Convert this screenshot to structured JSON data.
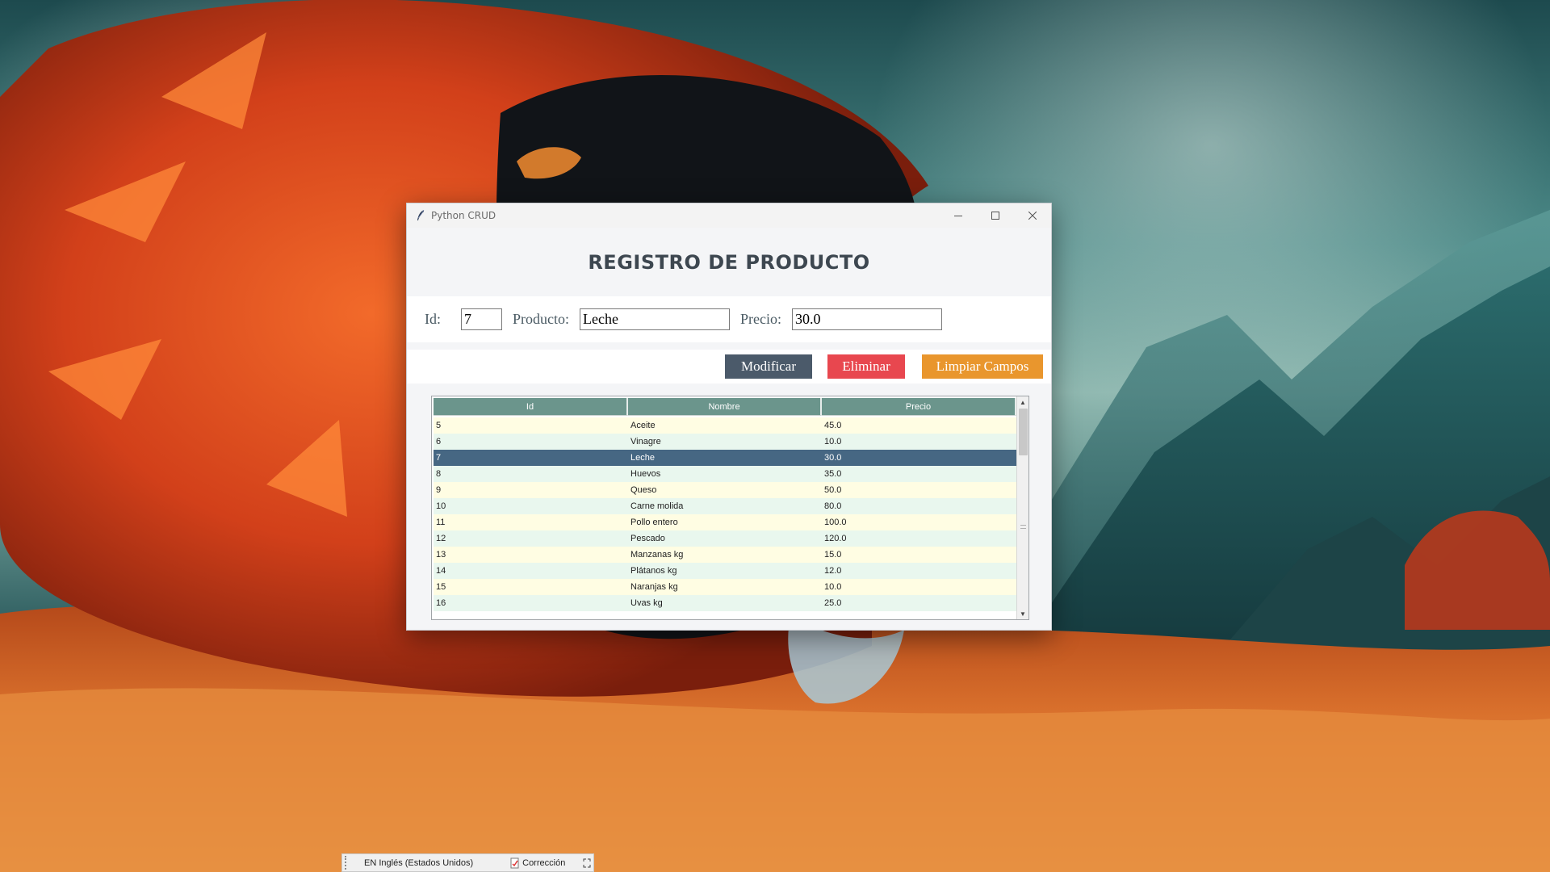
{
  "window": {
    "title": "Python CRUD",
    "controls": {
      "minimize": "minimize",
      "maximize": "maximize",
      "close": "close"
    }
  },
  "header": {
    "title": "REGISTRO DE PRODUCTO"
  },
  "form": {
    "id_label": "Id:",
    "id_value": "7",
    "product_label": "Producto:",
    "product_value": "Leche",
    "price_label": "Precio:",
    "price_value": "30.0"
  },
  "actions": {
    "modify_label": "Modificar",
    "delete_label": "Eliminar",
    "clear_label": "Limpiar Campos",
    "colors": {
      "modify": "#4b5a6a",
      "delete": "#e8474f",
      "clear": "#e9962d"
    }
  },
  "table": {
    "columns": [
      "Id",
      "Nombre",
      "Precio"
    ],
    "rows": [
      {
        "id": "5",
        "nombre": "Aceite",
        "precio": "45.0"
      },
      {
        "id": "6",
        "nombre": "Vinagre",
        "precio": "10.0"
      },
      {
        "id": "7",
        "nombre": "Leche",
        "precio": "30.0",
        "selected": true
      },
      {
        "id": "8",
        "nombre": "Huevos",
        "precio": "35.0"
      },
      {
        "id": "9",
        "nombre": "Queso",
        "precio": "50.0"
      },
      {
        "id": "10",
        "nombre": "Carne molida",
        "precio": "80.0"
      },
      {
        "id": "11",
        "nombre": "Pollo entero",
        "precio": "100.0"
      },
      {
        "id": "12",
        "nombre": "Pescado",
        "precio": "120.0"
      },
      {
        "id": "13",
        "nombre": "Manzanas kg",
        "precio": "15.0"
      },
      {
        "id": "14",
        "nombre": "Plátanos kg",
        "precio": "12.0"
      },
      {
        "id": "15",
        "nombre": "Naranjas kg",
        "precio": "10.0"
      },
      {
        "id": "16",
        "nombre": "Uvas kg",
        "precio": "25.0"
      }
    ],
    "colors": {
      "header": "#6b958c",
      "row_odd": "#fffde3",
      "row_even": "#e9f7ee",
      "selected": "#466783"
    }
  },
  "langbar": {
    "language": "EN Inglés (Estados Unidos)",
    "correction": "Corrección"
  }
}
